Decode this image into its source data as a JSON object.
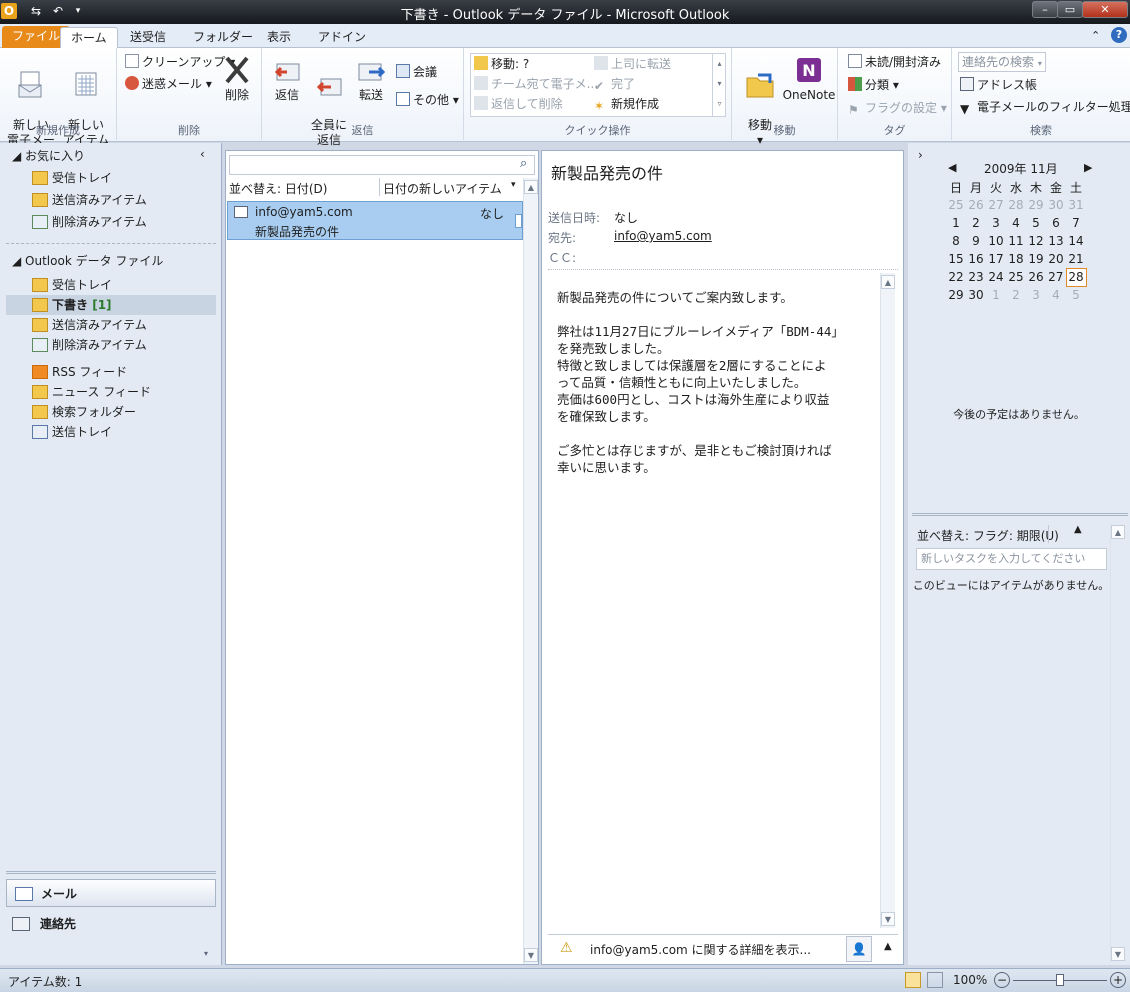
{
  "window": {
    "title": "下書き - Outlook データ ファイル - Microsoft Outlook",
    "app_icon": "O"
  },
  "tabs": [
    "ファイル",
    "ホーム",
    "送受信",
    "フォルダー",
    "表示",
    "アドイン"
  ],
  "ribbon": {
    "new_group": {
      "new_mail": "新しい\n電子メール",
      "new_items": "新しい\nアイテム ▾",
      "label": "新規作成"
    },
    "delete_group": {
      "cleanup": "クリーンアップ ▾",
      "junk": "迷惑メール ▾",
      "delete": "削除",
      "label": "削除"
    },
    "reply_group": {
      "reply": "返信",
      "reply_all": "全員に\n返信",
      "forward": "転送",
      "meeting": "会議",
      "more": "その他 ▾",
      "label": "返信"
    },
    "quick_group": {
      "move": "移動: ?",
      "team": "チーム宛て電子メ...",
      "reply_delete": "返信して削除",
      "to_manager": "上司に転送",
      "done": "完了",
      "create_new": "新規作成",
      "label": "クイック操作"
    },
    "move_group": {
      "move": "移動\n▾",
      "onenote": "OneNote",
      "label": "移動"
    },
    "tags_group": {
      "unread": "未読/開封済み",
      "categorize": "分類 ▾",
      "followup": "フラグの設定 ▾",
      "label": "タグ"
    },
    "find_group": {
      "search_contacts": "連絡先の検索",
      "address_book": "アドレス帳",
      "filter": "電子メールのフィルター処理 ▾",
      "label": "検索"
    }
  },
  "nav": {
    "favorites_header": "お気に入り",
    "favorites": [
      "受信トレイ",
      "送信済みアイテム",
      "削除済みアイテム"
    ],
    "data_file_header": "Outlook データ ファイル",
    "folders": [
      {
        "label": "受信トレイ"
      },
      {
        "label": "下書き",
        "count": "[1]"
      },
      {
        "label": "送信済みアイテム"
      },
      {
        "label": "削除済みアイテム"
      },
      {
        "label": "RSS フィード"
      },
      {
        "label": "ニュース フィード"
      },
      {
        "label": "検索フォルダー"
      },
      {
        "label": "送信トレイ"
      }
    ],
    "mail": "メール",
    "contacts": "連絡先"
  },
  "list": {
    "sort_by": "並べ替え: 日付(D)",
    "order": "日付の新しいアイテム",
    "item": {
      "from": "info@yam5.com",
      "subject": "新製品発売の件",
      "date": "なし"
    }
  },
  "reading": {
    "subject": "新製品発売の件",
    "sent_label": "送信日時:",
    "sent_value": "なし",
    "to_label": "宛先:",
    "to_value": "info@yam5.com",
    "cc_label": "ＣＣ:",
    "body": [
      "新製品発売の件についてご案内致します。",
      "",
      "弊社は11月27日にブルーレイメディア「BDM-44」",
      "を発売致しました。",
      "特徴と致しましては保護層を2層にすることによ",
      "って品質・信頼性ともに向上いたしました。",
      "売価は600円とし、コストは海外生産により収益",
      "を確保致します。",
      "",
      "ご多忙とは存じますが、是非ともご検討頂ければ",
      "幸いに思います。"
    ],
    "people_pane": "info@yam5.com に関する詳細を表示..."
  },
  "todo": {
    "month": "2009年 11月",
    "weekdays": [
      "日",
      "月",
      "火",
      "水",
      "木",
      "金",
      "土"
    ],
    "weeks": [
      [
        "25",
        "26",
        "27",
        "28",
        "29",
        "30",
        "31"
      ],
      [
        "1",
        "2",
        "3",
        "4",
        "5",
        "6",
        "7"
      ],
      [
        "8",
        "9",
        "10",
        "11",
        "12",
        "13",
        "14"
      ],
      [
        "15",
        "16",
        "17",
        "18",
        "19",
        "20",
        "21"
      ],
      [
        "22",
        "23",
        "24",
        "25",
        "26",
        "27",
        "28"
      ],
      [
        "29",
        "30",
        "1",
        "2",
        "3",
        "4",
        "5"
      ]
    ],
    "no_appointments": "今後の予定はありません。",
    "task_sort": "並べ替え: フラグ: 期限(U)",
    "task_placeholder": "新しいタスクを入力してください",
    "no_items": "このビューにはアイテムがありません。"
  },
  "status": {
    "items": "アイテム数: 1",
    "zoom": "100%"
  }
}
